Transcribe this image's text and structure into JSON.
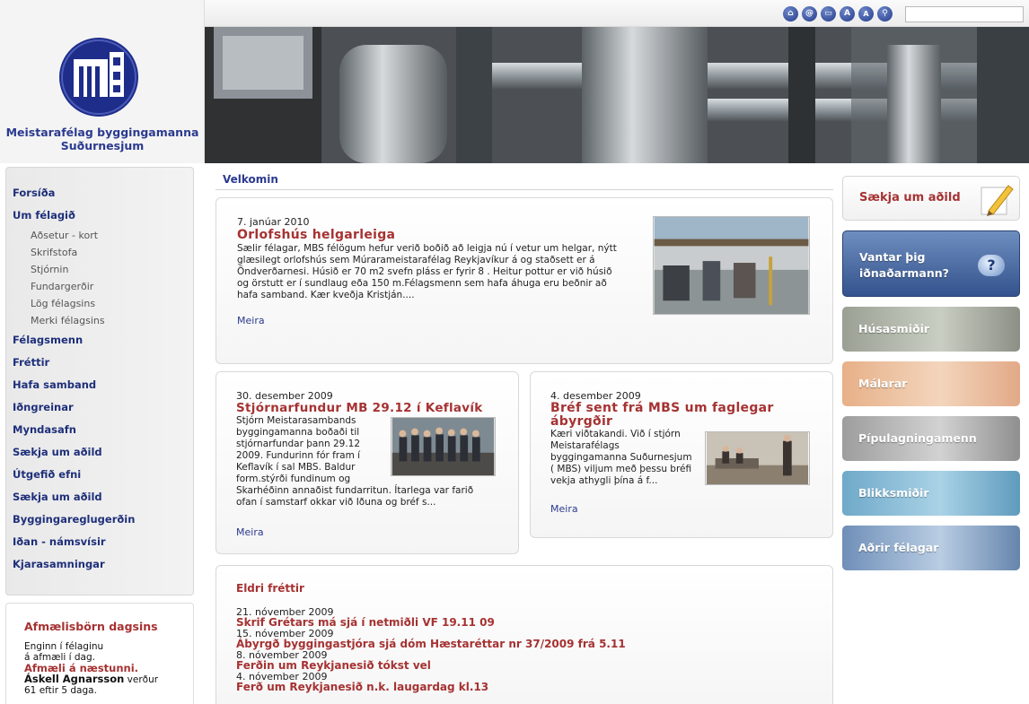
{
  "top": {
    "search_placeholder": "",
    "tools": [
      "home",
      "email",
      "print",
      "font-larger",
      "font-smaller",
      "search"
    ]
  },
  "org": {
    "line1": "Meistarafélag byggingamanna",
    "line2": "Suðurnesjum"
  },
  "nav": {
    "main1": "Forsíða",
    "main2": "Um félagið",
    "sub": [
      "Aðsetur - kort",
      "Skrifstofa",
      "Stjórnin",
      "Fundargerðir",
      "Lög félagsins",
      "Merki félagsins"
    ],
    "rest": [
      "Félagsmenn",
      "Fréttir",
      "Hafa samband",
      "Iðngreinar",
      "Myndasafn",
      "Sækja um aðild",
      "Útgefið efni",
      "Sækja um aðild",
      "Byggingareglugerðin",
      "Iðan - námsvísir",
      "Kjarasamningar"
    ]
  },
  "birthdays": {
    "title": "Afmælisbörn dagsins",
    "none1": "Enginn í félaginu",
    "none2": "á afmæli í dag.",
    "next": "Afmæli á næstunni.",
    "name": "Áskell Agnarsson",
    "name_suffix": " verður",
    "when": "61 eftir 5 daga."
  },
  "welcome": "Velkomin",
  "articles": [
    {
      "date": "7. janúar 2010",
      "title": "Orlofshús helgarleiga",
      "lines": [
        "Sælir félagar, MBS félögum hefur verið boðið að leigja nú í vetur um helgar, nýtt",
        "glæsilegt orlofshús sem Múrarameistarafélag Reykjavíkur á og staðsett er á",
        "Öndverðarnesi. Húsið er 70 m2 svefn pláss er fyrir 8 . Heitur pottur er við húsið",
        "og örstutt er í sundlaug eða 150 m.Félagsmenn sem hafa áhuga eru beðnir að",
        "hafa samband. Kær kveðja Kristján...."
      ],
      "more": "Meira"
    },
    {
      "date": "30. desember 2009",
      "title": "Stjórnarfundur MB 29.12 í Keflavík",
      "lines": [
        "Stjórn Meistarasambands",
        "byggingamanna boðaði til",
        "stjórnarfundar þann 29.12",
        "2009. Fundurinn fór fram í",
        "Keflavík í sal MBS. Baldur",
        "form.stýrði fundinum og",
        "Skarhéðinn annaðist fundarritun. Ítarlega var farið",
        "ofan í samstarf okkar við Iðuna og bréf s..."
      ],
      "more": "Meira"
    },
    {
      "date": "4. desember 2009",
      "title1": "Bréf sent frá MBS um faglegar",
      "title2": "ábyrgðir",
      "lines": [
        "Kæri viðtakandi. Við í stjórn",
        "Meistarafélags",
        "byggingamanna Suðurnesjum",
        "( MBS) viljum með þessu bréfi",
        "vekja athygli þína á f..."
      ],
      "more": "Meira"
    }
  ],
  "older": {
    "title": "Eldri fréttir",
    "items": [
      {
        "date": "21. nóvember 2009",
        "title": "Skrif Grétars má sjá í netmiðli VF 19.11 09"
      },
      {
        "date": "15. nóvember 2009",
        "title": "Ábyrgð byggingastjóra sjá dóm Hæstaréttar nr 37/2009 frá 5.11"
      },
      {
        "date": "8. nóvember 2009",
        "title": "Ferðin um Reykjanesið tókst vel"
      },
      {
        "date": "4. nóvember 2009",
        "title": "Ferð um Reykjanesið n.k. laugardag kl.13"
      }
    ]
  },
  "promos": {
    "apply": "Sækja um aðild",
    "need1": "Vantar þig",
    "need2": "iðnaðarmann?",
    "trades": [
      "Húsasmiðir",
      "Málarar",
      "Pípulagningamenn",
      "Blikksmiðir",
      "Aðrir félagar"
    ]
  },
  "colors": {
    "brand_blue": "#2b3a8f",
    "headline_red": "#a63232"
  }
}
